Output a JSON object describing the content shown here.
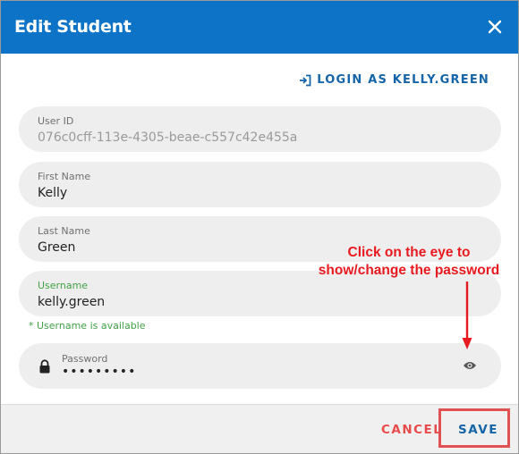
{
  "dialog": {
    "title": "Edit Student"
  },
  "login_link": {
    "label": "LOGIN AS KELLY.GREEN"
  },
  "fields": {
    "user_id": {
      "label": "User ID",
      "value": "076c0cff-113e-4305-beae-c557c42e455a"
    },
    "first_name": {
      "label": "First Name",
      "value": "Kelly"
    },
    "last_name": {
      "label": "Last Name",
      "value": "Green"
    },
    "username": {
      "label": "Username",
      "value": "kelly.green",
      "hint": "* Username is available"
    },
    "password": {
      "label": "Password",
      "value": "•••••••••"
    }
  },
  "annotation": {
    "line1": "Click on the eye to",
    "line2": "show/change the password"
  },
  "footer": {
    "cancel_label": "CANCEL",
    "save_label": "SAVE"
  },
  "colors": {
    "header": "#0c73c6",
    "link": "#1565a8",
    "success": "#43a047",
    "cancel": "#e84b4b",
    "annotation": "#e8191f"
  },
  "icons": {
    "close": "close-icon",
    "login": "login-icon",
    "lock": "lock-icon",
    "eye": "eye-icon",
    "arrow": "arrow-down-icon"
  }
}
